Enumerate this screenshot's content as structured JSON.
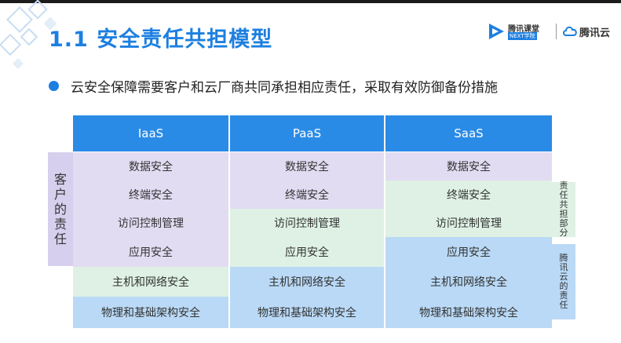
{
  "title": "1.1 安全责任共担模型",
  "logos": {
    "edu_name": "腾讯课堂",
    "edu_sub": "NEXT学院",
    "cloud_name": "腾讯云"
  },
  "bullet": "云安全保障需要客户和云厂商共同承担相应责任，采取有效防御备份措施",
  "columns": [
    "IaaS",
    "PaaS",
    "SaaS"
  ],
  "rows": [
    [
      "数据安全",
      "数据安全",
      "数据安全"
    ],
    [
      "终端安全",
      "终端安全",
      "终端安全"
    ],
    [
      "访问控制管理",
      "访问控制管理",
      "访问控制管理"
    ],
    [
      "应用安全",
      "应用安全",
      "应用安全"
    ],
    [
      "主机和网络安全",
      "主机和网络安全",
      "主机和网络安全"
    ],
    [
      "物理和基础架构安全",
      "物理和基础架构安全",
      "物理和基础架构安全"
    ]
  ],
  "side_labels": {
    "customer": "客户的责任",
    "shared": "责任共担部分",
    "tencent": "腾讯云的责任"
  },
  "colors": {
    "accent": "#1d7fe0",
    "header": "#2a8be6",
    "customer": "#e1dcf2",
    "shared": "#def1e4",
    "provider": "#b9d9f6"
  }
}
